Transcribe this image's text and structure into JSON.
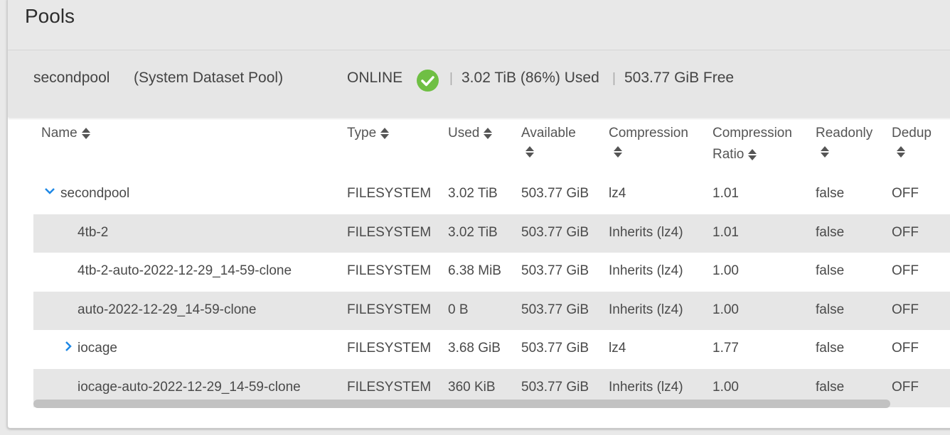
{
  "page": {
    "title": "Pools"
  },
  "pool": {
    "name": "secondpool",
    "role": "(System Dataset Pool)",
    "status": "ONLINE",
    "status_icon": "check-circle-icon",
    "used": "3.02 TiB (86%) Used",
    "free": "503.77 GiB Free",
    "separator": "|",
    "status_color": "#6fbf44"
  },
  "table": {
    "columns": {
      "name": "Name",
      "type": "Type",
      "used": "Used",
      "available": "Available",
      "compression": "Compression",
      "compression_ratio_1": "Compression",
      "compression_ratio_2": "Ratio",
      "readonly": "Readonly",
      "dedup": "Dedup"
    },
    "rows": [
      {
        "name": "secondpool",
        "type": "FILESYSTEM",
        "used": "3.02 TiB",
        "available": "503.77 GiB",
        "compression": "lz4",
        "ratio": "1.01",
        "readonly": "false",
        "dedup": "OFF",
        "expander": "chevron-down-icon"
      },
      {
        "name": "4tb-2",
        "type": "FILESYSTEM",
        "used": "3.02 TiB",
        "available": "503.77 GiB",
        "compression": "Inherits (lz4)",
        "ratio": "1.01",
        "readonly": "false",
        "dedup": "OFF"
      },
      {
        "name": "4tb-2-auto-2022-12-29_14-59-clone",
        "type": "FILESYSTEM",
        "used": "6.38 MiB",
        "available": "503.77 GiB",
        "compression": "Inherits (lz4)",
        "ratio": "1.00",
        "readonly": "false",
        "dedup": "OFF"
      },
      {
        "name": "auto-2022-12-29_14-59-clone",
        "type": "FILESYSTEM",
        "used": "0 B",
        "available": "503.77 GiB",
        "compression": "Inherits (lz4)",
        "ratio": "1.00",
        "readonly": "false",
        "dedup": "OFF"
      },
      {
        "name": "iocage",
        "type": "FILESYSTEM",
        "used": "3.68 GiB",
        "available": "503.77 GiB",
        "compression": "lz4",
        "ratio": "1.77",
        "readonly": "false",
        "dedup": "OFF",
        "expander": "chevron-right-icon"
      },
      {
        "name": "iocage-auto-2022-12-29_14-59-clone",
        "type": "FILESYSTEM",
        "used": "360 KiB",
        "available": "503.77 GiB",
        "compression": "Inherits (lz4)",
        "ratio": "1.00",
        "readonly": "false",
        "dedup": "OFF"
      }
    ]
  }
}
